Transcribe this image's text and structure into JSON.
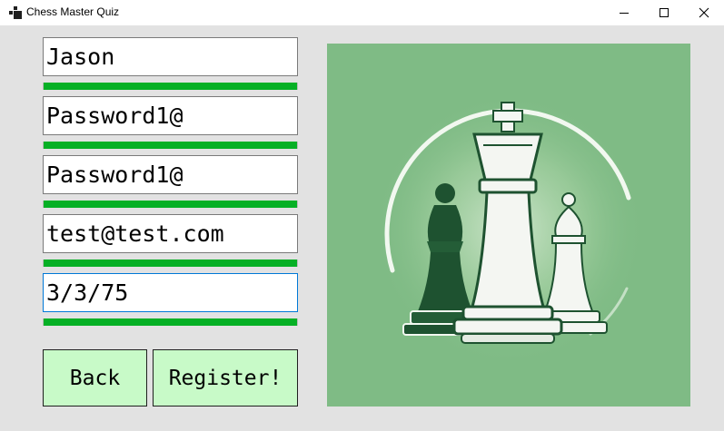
{
  "window": {
    "title": "Chess Master Quiz",
    "controls": [
      "minimize",
      "maximize",
      "close"
    ]
  },
  "form": {
    "fields": [
      {
        "name": "username",
        "value": "Jason",
        "strength": 1.0
      },
      {
        "name": "password",
        "value": "Password1@",
        "strength": 1.0
      },
      {
        "name": "confirm-password",
        "value": "Password1@",
        "strength": 1.0
      },
      {
        "name": "email",
        "value": "test@test.com",
        "strength": 1.0
      },
      {
        "name": "date-of-birth",
        "value": "3/3/75",
        "strength": 1.0
      }
    ],
    "back_label": "Back",
    "register_label": "Register!"
  },
  "image": {
    "subject": "chess pieces logo (king, bishop, pawn) on green"
  },
  "colors": {
    "client_bg": "#e2e2e2",
    "indicator_green": "#06b025",
    "button_bg": "#c8fac8",
    "focus_border": "#0078d7",
    "image_bg": "#7fbb85"
  }
}
